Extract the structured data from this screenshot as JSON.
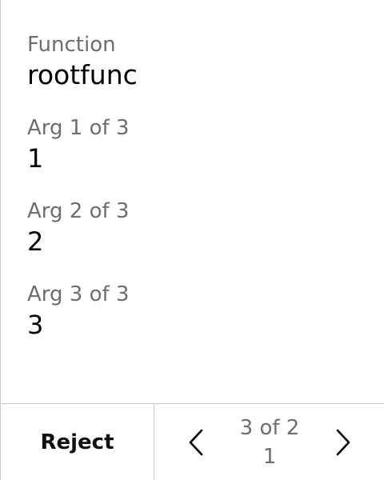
{
  "function": {
    "label": "Function",
    "value": "rootfunc"
  },
  "args": [
    {
      "label": "Arg 1 of 3",
      "value": "1"
    },
    {
      "label": "Arg 2 of 3",
      "value": "2"
    },
    {
      "label": "Arg 3 of 3",
      "value": "3"
    }
  ],
  "footer": {
    "reject_label": "Reject",
    "counter_line1": "3 of 2",
    "counter_line2": "1",
    "prev_icon": "chevron-left-icon",
    "next_icon": "chevron-right-icon"
  },
  "colors": {
    "label": "#6e6e6e",
    "value": "#000000",
    "divider": "#c8c8c8"
  }
}
